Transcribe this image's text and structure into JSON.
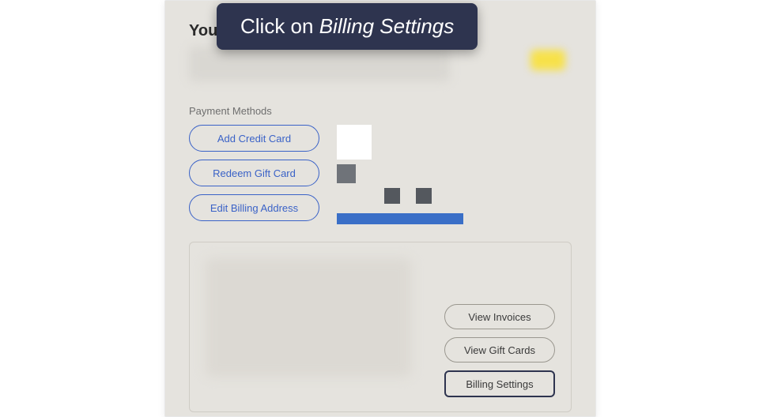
{
  "callout": {
    "prefix": "Click on ",
    "emphasis": "Billing Settings"
  },
  "heading": {
    "prefix": "You"
  },
  "payment": {
    "section_label": "Payment Methods",
    "add_card": "Add Credit Card",
    "redeem_gift": "Redeem Gift Card",
    "edit_address": "Edit Billing Address"
  },
  "actions": {
    "view_invoices": "View Invoices",
    "view_gift_cards": "View Gift Cards",
    "billing_settings": "Billing Settings"
  }
}
